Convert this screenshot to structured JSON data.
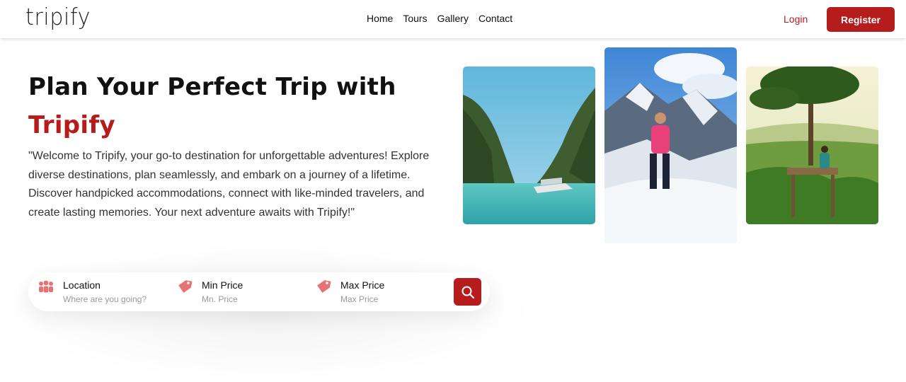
{
  "header": {
    "logo": "tripify",
    "nav": [
      "Home",
      "Tours",
      "Gallery",
      "Contact"
    ],
    "login_label": "Login",
    "register_label": "Register"
  },
  "hero": {
    "title_line1": "Plan Your Perfect Trip with",
    "title_line2": "Tripify",
    "description": "\"Welcome to Tripify, your go-to destination for unforgettable adventures! Explore diverse destinations, plan seamlessly, and embark on a journey of a lifetime. Discover handpicked accommodations, connect with like-minded travelers, and create lasting memories. Your next adventure awaits with Tripify!\""
  },
  "photos": [
    {
      "name": "lagoon-boat-photo"
    },
    {
      "name": "mountain-climber-photo"
    },
    {
      "name": "treehouse-view-photo"
    }
  ],
  "search": {
    "location": {
      "label": "Location",
      "placeholder": "Where are you going?",
      "icon": "people-icon"
    },
    "min_price": {
      "label": "Min Price",
      "placeholder": "Mn. Price",
      "icon": "price-tag-icon"
    },
    "max_price": {
      "label": "Max Price",
      "placeholder": "Max Price",
      "icon": "price-tag-icon"
    },
    "button_icon": "search-icon"
  },
  "colors": {
    "brand": "#b71c1c",
    "text": "#111111",
    "muted": "#9a9a9a"
  }
}
